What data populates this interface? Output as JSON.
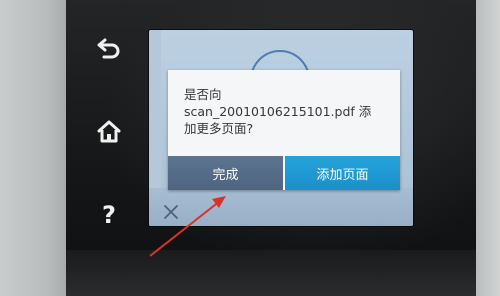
{
  "device": {
    "side_buttons": {
      "back_icon": "back-arrow-icon",
      "home_icon": "home-icon",
      "help_label": "?"
    }
  },
  "dialog": {
    "message_line1": "是否向",
    "message_line2": "scan_20010106215101.pdf 添",
    "message_line3": "加更多页面?",
    "done_label": "完成",
    "add_page_label": "添加页面"
  },
  "screen": {
    "close_icon": "close-icon"
  },
  "colors": {
    "done_button": "#53697f",
    "add_button": "#1f98d0",
    "annotation_arrow": "#d9322c"
  }
}
